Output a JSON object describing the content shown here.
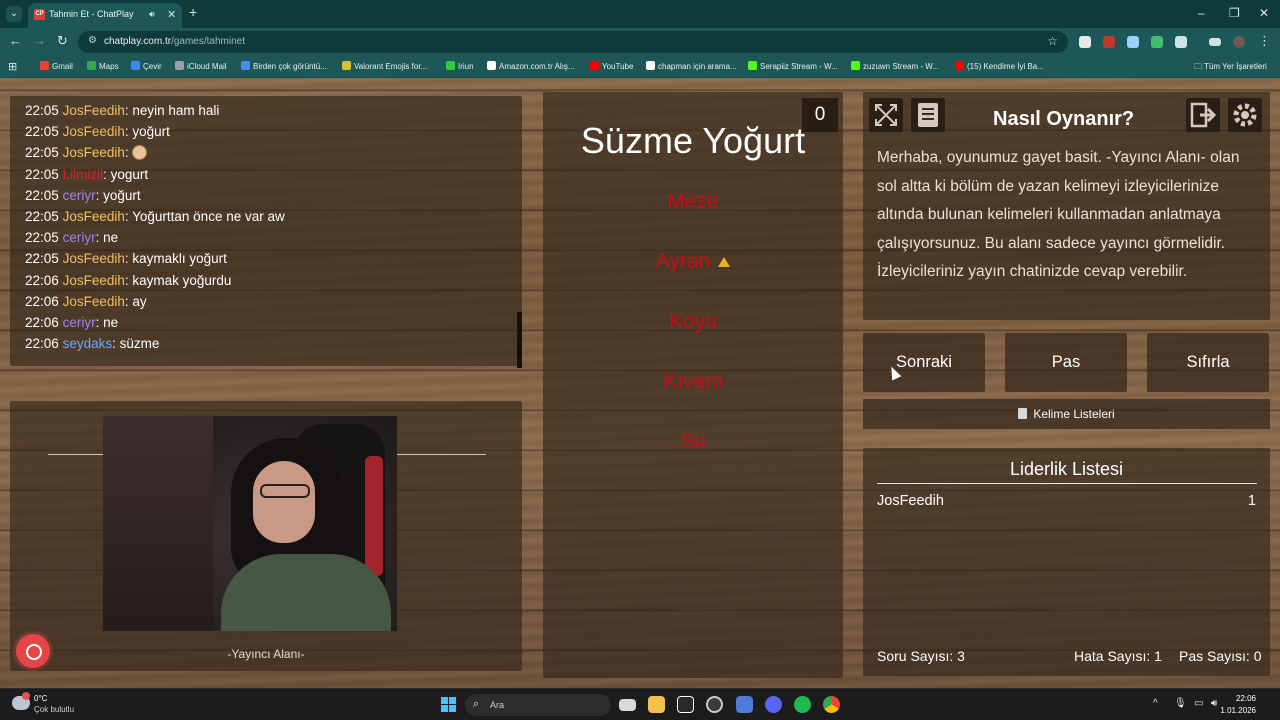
{
  "browser": {
    "tab_title": "Tahmin Et - ChatPlay",
    "tab_favicon": "CP",
    "url_domain": "chatplay.com.tr",
    "url_path": "/games/tahminet",
    "bookmarks": [
      {
        "label": "Gmail",
        "icon_color": "#ea4335"
      },
      {
        "label": "Maps",
        "icon_color": "#34a853"
      },
      {
        "label": "Çevir",
        "icon_color": "#4285f4"
      },
      {
        "label": "iCloud Mail",
        "icon_color": "#9aa0a6"
      },
      {
        "label": "Birden çok görüntü...",
        "icon_color": "#4a8bf5"
      },
      {
        "label": "Valorant Emojis for...",
        "icon_color": "#d6c23a"
      },
      {
        "label": "Iriun",
        "icon_color": "#2ecc40"
      },
      {
        "label": "Amazon.com.tr Alış...",
        "icon_color": "#ffffff"
      },
      {
        "label": "YouTube",
        "icon_color": "#ff0000"
      },
      {
        "label": "chapman için arama...",
        "icon_color": "#ffffff"
      },
      {
        "label": "Serapiiz Stream - W...",
        "icon_color": "#53fc18"
      },
      {
        "label": "zuzuwn Stream - W...",
        "icon_color": "#53fc18"
      },
      {
        "label": "(15) Kendime İyi Ba...",
        "icon_color": "#ff0000"
      }
    ],
    "all_bookmarks": "Tüm Yer İşaretleri"
  },
  "chat": {
    "messages": [
      {
        "time": "22:05",
        "user": "JosFeedih",
        "color": "gold",
        "text": "neyin ham hali"
      },
      {
        "time": "22:05",
        "user": "JosFeedih",
        "color": "gold",
        "text": "yoğurt"
      },
      {
        "time": "22:05",
        "user": "JosFeedih",
        "color": "gold",
        "text": "",
        "emote": true
      },
      {
        "time": "22:05",
        "user": "Lilmizil",
        "color": "red",
        "text": "yogurt"
      },
      {
        "time": "22:05",
        "user": "ceriyr",
        "color": "purple",
        "text": "yoğurt"
      },
      {
        "time": "22:05",
        "user": "JosFeedih",
        "color": "gold",
        "text": "Yoğurttan önce ne var aw"
      },
      {
        "time": "22:05",
        "user": "ceriyr",
        "color": "purple",
        "text": "ne"
      },
      {
        "time": "22:05",
        "user": "JosFeedih",
        "color": "gold",
        "text": "kaymaklı yoğurt"
      },
      {
        "time": "22:06",
        "user": "JosFeedih",
        "color": "gold",
        "text": "kaymak yoğurdu"
      },
      {
        "time": "22:06",
        "user": "JosFeedih",
        "color": "gold",
        "text": "ay"
      },
      {
        "time": "22:06",
        "user": "ceriyr",
        "color": "purple",
        "text": "ne"
      },
      {
        "time": "22:06",
        "user": "seydaks",
        "color": "blue",
        "text": "süzme"
      }
    ]
  },
  "streamer": {
    "label": "-Yayıncı Alanı-"
  },
  "card": {
    "counter": "0",
    "word": "Süzme Yoğurt",
    "taboo": [
      "Meze",
      "Ayran",
      "Koyu",
      "Kıvam",
      "Su"
    ]
  },
  "howto": {
    "title": "Nasıl Oynanır?",
    "text": "Merhaba, oyunumuz gayet basit. -Yayıncı Alanı- olan sol altta ki bölüm de yazan kelimeyi izleyicilerinize altında bulunan kelimeleri kullanmadan anlatmaya çalışıyorsunuz. Bu alanı sadece yayıncı görmelidir. İzleyicileriniz yayın chatinizde cevap verebilir."
  },
  "actions": {
    "next": "Sonraki",
    "pass": "Pas",
    "reset": "Sıfırla",
    "word_lists": "Kelime Listeleri"
  },
  "leaderboard": {
    "title": "Liderlik Listesi",
    "rows": [
      {
        "name": "JosFeedih",
        "score": "1"
      }
    ],
    "question_count": "Soru Sayısı: 3",
    "error_count": "Hata Sayısı: 1",
    "pass_count": "Pas Sayısı: 0"
  },
  "taskbar": {
    "temp": "0°C",
    "weather": "Çok bulutlu",
    "search_placeholder": "Ara",
    "time": "22:06",
    "date": "1.01.2026"
  }
}
